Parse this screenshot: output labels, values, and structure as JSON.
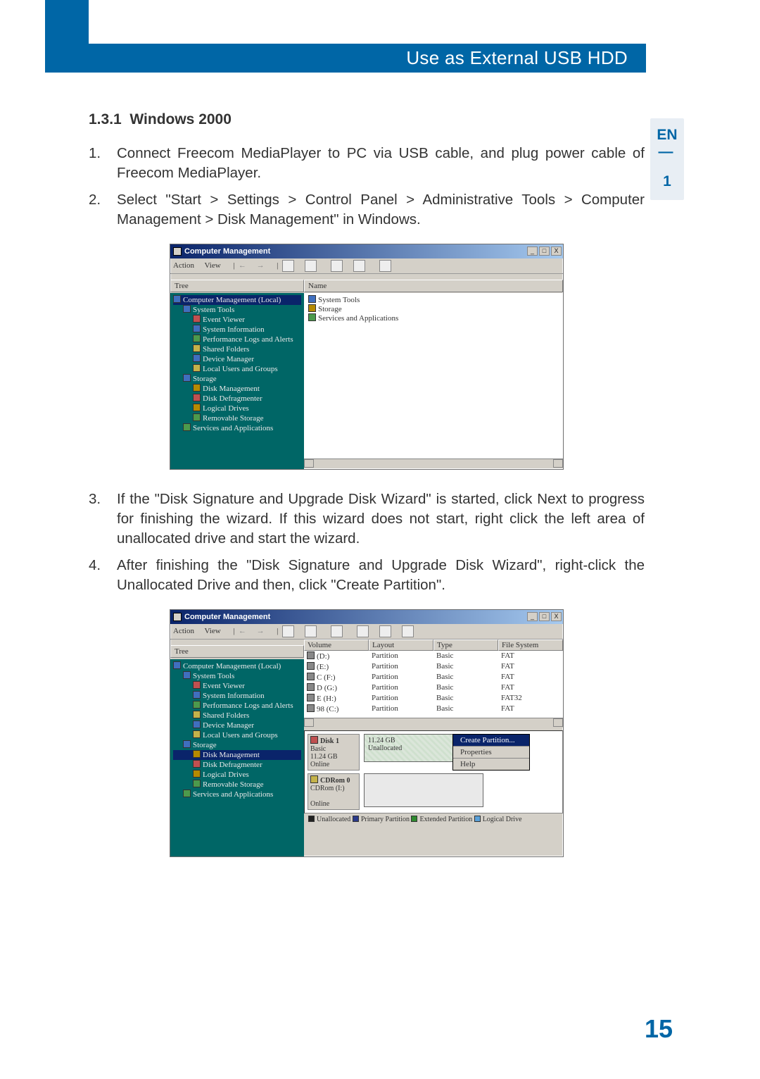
{
  "header": {
    "title": "Use as External USB HDD"
  },
  "side": {
    "lang": "EN",
    "sep": "—",
    "chapter": "1"
  },
  "section": {
    "number": "1.3.1",
    "title": "Windows 2000"
  },
  "steps": [
    "Connect Freecom MediaPlayer to PC via USB cable, and plug power cable of Freecom MediaPlayer.",
    "Select \"Start > Settings > Control Panel > Administrative Tools > Computer Management > Disk Management\" in Windows.",
    "If the \"Disk Signature and Upgrade Disk Wizard\" is started, click Next to progress for finishing the wizard. If this wizard does not start, right click the left area of unallocated drive and start the wizard.",
    "After finishing the \"Disk Signature and Upgrade Disk Wizard\", right-click the Unallocated Drive and then, click \"Create Partition\"."
  ],
  "page_number": "15",
  "shotA": {
    "window_title": "Computer Management",
    "menu": [
      "Action",
      "View"
    ],
    "left_header": "Tree",
    "right_header": "Name",
    "tree": [
      {
        "t": "Computer Management (Local)",
        "i": 0,
        "sel": true,
        "c": "b"
      },
      {
        "t": "System Tools",
        "i": 1,
        "c": "b"
      },
      {
        "t": "Event Viewer",
        "i": 2,
        "c": "r"
      },
      {
        "t": "System Information",
        "i": 2,
        "c": "b"
      },
      {
        "t": "Performance Logs and Alerts",
        "i": 2,
        "c": "g"
      },
      {
        "t": "Shared Folders",
        "i": 2,
        "c": "y"
      },
      {
        "t": "Device Manager",
        "i": 2,
        "c": "b"
      },
      {
        "t": "Local Users and Groups",
        "i": 2,
        "c": "y"
      },
      {
        "t": "Storage",
        "i": 1,
        "c": "b"
      },
      {
        "t": "Disk Management",
        "i": 2,
        "c": ""
      },
      {
        "t": "Disk Defragmenter",
        "i": 2,
        "c": "r"
      },
      {
        "t": "Logical Drives",
        "i": 2,
        "c": ""
      },
      {
        "t": "Removable Storage",
        "i": 2,
        "c": "g"
      },
      {
        "t": "Services and Applications",
        "i": 1,
        "c": "g"
      }
    ],
    "right_rows": [
      "System Tools",
      "Storage",
      "Services and Applications"
    ],
    "btns": [
      "_",
      "□",
      "X"
    ]
  },
  "shotB": {
    "window_title": "Computer Management",
    "menu": [
      "Action",
      "View"
    ],
    "left_header": "Tree",
    "columns": [
      "Volume",
      "Layout",
      "Type",
      "File System"
    ],
    "tree": [
      {
        "t": "Computer Management (Local)",
        "i": 0,
        "c": "b"
      },
      {
        "t": "System Tools",
        "i": 1,
        "c": "b"
      },
      {
        "t": "Event Viewer",
        "i": 2,
        "c": "r"
      },
      {
        "t": "System Information",
        "i": 2,
        "c": "b"
      },
      {
        "t": "Performance Logs and Alerts",
        "i": 2,
        "c": "g"
      },
      {
        "t": "Shared Folders",
        "i": 2,
        "c": "y"
      },
      {
        "t": "Device Manager",
        "i": 2,
        "c": "b"
      },
      {
        "t": "Local Users and Groups",
        "i": 2,
        "c": "y"
      },
      {
        "t": "Storage",
        "i": 1,
        "c": "b"
      },
      {
        "t": "Disk Management",
        "i": 2,
        "sel": true,
        "c": ""
      },
      {
        "t": "Disk Defragmenter",
        "i": 2,
        "c": "r"
      },
      {
        "t": "Logical Drives",
        "i": 2,
        "c": ""
      },
      {
        "t": "Removable Storage",
        "i": 2,
        "c": "g"
      },
      {
        "t": "Services and Applications",
        "i": 1,
        "c": "g"
      }
    ],
    "volumes": [
      {
        "v": "(D:)",
        "l": "Partition",
        "t": "Basic",
        "f": "FAT"
      },
      {
        "v": "(E:)",
        "l": "Partition",
        "t": "Basic",
        "f": "FAT"
      },
      {
        "v": "C (F:)",
        "l": "Partition",
        "t": "Basic",
        "f": "FAT"
      },
      {
        "v": "D (G:)",
        "l": "Partition",
        "t": "Basic",
        "f": "FAT"
      },
      {
        "v": "E (H:)",
        "l": "Partition",
        "t": "Basic",
        "f": "FAT32"
      },
      {
        "v": "98 (C:)",
        "l": "Partition",
        "t": "Basic",
        "f": "FAT"
      }
    ],
    "disk1": {
      "label": "Disk 1",
      "type": "Basic",
      "size": "11.24 GB",
      "status": "Online",
      "bar_size": "11.24 GB",
      "bar_status": "Unallocated"
    },
    "cdrom": {
      "label": "CDRom 0",
      "sub": "CDRom (I:)",
      "status": "Online"
    },
    "context_menu": [
      "Create Partition...",
      "Properties",
      "Help"
    ],
    "legend": [
      "Unallocated",
      "Primary Partition",
      "Extended Partition",
      "Logical Drive"
    ],
    "legend_colors": [
      "#222",
      "#2a3a8a",
      "#2f8a2f",
      "#5aa0d8"
    ],
    "btns": [
      "_",
      "□",
      "X"
    ]
  }
}
